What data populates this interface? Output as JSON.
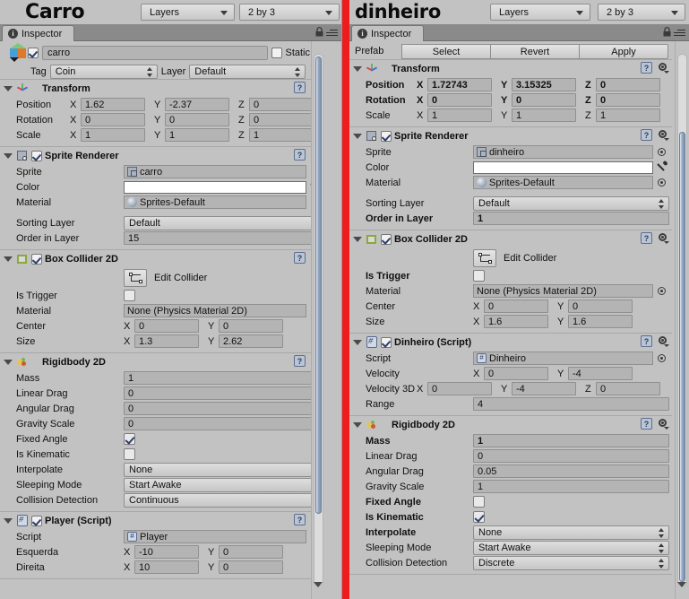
{
  "window": {
    "background_color": "#c2c2c2",
    "divider_color": "#ee1c1c"
  },
  "panels": [
    {
      "id": "left",
      "toolbar": {
        "object_title": "Carro",
        "layers_dropdown": "Layers",
        "layout_dropdown": "2 by 3"
      },
      "tab": {
        "label": "Inspector",
        "icon": "info-icon"
      },
      "object_header": {
        "enabled": true,
        "name": "carro",
        "static_label": "Static",
        "tag_label": "Tag",
        "tag_value": "Coin",
        "layer_label": "Layer",
        "layer_value": "Default"
      },
      "prefab_row": null,
      "components": [
        {
          "name": "Transform",
          "icon": "transform-axis-icon",
          "has_enable_checkbox": false,
          "enabled": false,
          "rows": [
            {
              "type": "vector3",
              "label": "Position",
              "bold": false,
              "x": "1.62",
              "y": "-2.37",
              "z": "0"
            },
            {
              "type": "vector3",
              "label": "Rotation",
              "bold": false,
              "x": "0",
              "y": "0",
              "z": "0"
            },
            {
              "type": "vector3",
              "label": "Scale",
              "bold": false,
              "x": "1",
              "y": "1",
              "z": "1"
            }
          ]
        },
        {
          "name": "Sprite Renderer",
          "icon": "sprite-renderer-icon",
          "has_enable_checkbox": true,
          "enabled": true,
          "rows": [
            {
              "type": "object",
              "label": "Sprite",
              "bold": false,
              "value": "carro",
              "icon": "sprite-asset-icon"
            },
            {
              "type": "color",
              "label": "Color",
              "bold": false,
              "value": "#ffffff"
            },
            {
              "type": "object",
              "label": "Material",
              "bold": false,
              "value": "Sprites-Default",
              "icon": "material-ball-icon"
            },
            {
              "type": "spacer"
            },
            {
              "type": "popup",
              "label": "Sorting Layer",
              "bold": false,
              "value": "Default"
            },
            {
              "type": "text",
              "label": "Order in Layer",
              "bold": false,
              "value": "15"
            }
          ]
        },
        {
          "name": "Box Collider 2D",
          "icon": "box-collider-2d-icon",
          "has_enable_checkbox": true,
          "enabled": true,
          "rows": [
            {
              "type": "editcollider",
              "label": "Edit Collider"
            },
            {
              "type": "checkbox",
              "label": "Is Trigger",
              "bold": false,
              "checked": false
            },
            {
              "type": "object",
              "label": "Material",
              "bold": false,
              "value": "None (Physics Material 2D)",
              "icon": "none-icon"
            },
            {
              "type": "vector2",
              "label": "Center",
              "bold": false,
              "x": "0",
              "y": "0"
            },
            {
              "type": "vector2",
              "label": "Size",
              "bold": false,
              "x": "1.3",
              "y": "2.62"
            }
          ]
        },
        {
          "name": "Rigidbody 2D",
          "icon": "rigidbody-2d-icon",
          "has_enable_checkbox": false,
          "enabled": false,
          "rows": [
            {
              "type": "text",
              "label": "Mass",
              "bold": false,
              "value": "1"
            },
            {
              "type": "text",
              "label": "Linear Drag",
              "bold": false,
              "value": "0"
            },
            {
              "type": "text",
              "label": "Angular Drag",
              "bold": false,
              "value": "0"
            },
            {
              "type": "text",
              "label": "Gravity Scale",
              "bold": false,
              "value": "0"
            },
            {
              "type": "checkbox",
              "label": "Fixed Angle",
              "bold": false,
              "checked": true
            },
            {
              "type": "checkbox",
              "label": "Is Kinematic",
              "bold": false,
              "checked": false
            },
            {
              "type": "popup",
              "label": "Interpolate",
              "bold": false,
              "value": "None"
            },
            {
              "type": "popup",
              "label": "Sleeping Mode",
              "bold": false,
              "value": "Start Awake"
            },
            {
              "type": "popup",
              "label": "Collision Detection",
              "bold": false,
              "value": "Continuous"
            }
          ]
        },
        {
          "name": "Player (Script)",
          "icon": "script-icon",
          "has_enable_checkbox": true,
          "enabled": true,
          "rows": [
            {
              "type": "object",
              "label": "Script",
              "bold": false,
              "value": "Player",
              "icon": "script-asset-icon"
            },
            {
              "type": "vector2",
              "label": "Esquerda",
              "bold": false,
              "x": "-10",
              "y": "0"
            },
            {
              "type": "vector2",
              "label": "Direita",
              "bold": false,
              "x": "10",
              "y": "0"
            }
          ]
        }
      ]
    },
    {
      "id": "right",
      "toolbar": {
        "object_title": "dinheiro",
        "layers_dropdown": "Layers",
        "layout_dropdown": "2 by 3"
      },
      "tab": {
        "label": "Inspector",
        "icon": "info-icon"
      },
      "object_header": null,
      "prefab_row": {
        "label": "Prefab",
        "select_button": "Select",
        "revert_button": "Revert",
        "apply_button": "Apply"
      },
      "components": [
        {
          "name": "Transform",
          "icon": "transform-axis-icon",
          "has_enable_checkbox": false,
          "enabled": false,
          "rows": [
            {
              "type": "vector3",
              "label": "Position",
              "bold": true,
              "x": "1.72743",
              "y": "3.15325",
              "z": "0"
            },
            {
              "type": "vector3",
              "label": "Rotation",
              "bold": true,
              "x": "0",
              "y": "0",
              "z": "0"
            },
            {
              "type": "vector3",
              "label": "Scale",
              "bold": false,
              "x": "1",
              "y": "1",
              "z": "1"
            }
          ]
        },
        {
          "name": "Sprite Renderer",
          "icon": "sprite-renderer-icon",
          "has_enable_checkbox": true,
          "enabled": true,
          "rows": [
            {
              "type": "object",
              "label": "Sprite",
              "bold": false,
              "value": "dinheiro",
              "icon": "sprite-asset-icon"
            },
            {
              "type": "color",
              "label": "Color",
              "bold": false,
              "value": "#ffffff"
            },
            {
              "type": "object",
              "label": "Material",
              "bold": false,
              "value": "Sprites-Default",
              "icon": "material-ball-icon"
            },
            {
              "type": "spacer"
            },
            {
              "type": "popup",
              "label": "Sorting Layer",
              "bold": false,
              "value": "Default"
            },
            {
              "type": "text",
              "label": "Order in Layer",
              "bold": true,
              "value": "1"
            }
          ]
        },
        {
          "name": "Box Collider 2D",
          "icon": "box-collider-2d-icon",
          "has_enable_checkbox": true,
          "enabled": true,
          "rows": [
            {
              "type": "editcollider",
              "label": "Edit Collider"
            },
            {
              "type": "checkbox",
              "label": "Is Trigger",
              "bold": true,
              "checked": false
            },
            {
              "type": "object",
              "label": "Material",
              "bold": false,
              "value": "None (Physics Material 2D)",
              "icon": "none-icon"
            },
            {
              "type": "vector2",
              "label": "Center",
              "bold": false,
              "x": "0",
              "y": "0"
            },
            {
              "type": "vector2",
              "label": "Size",
              "bold": false,
              "x": "1.6",
              "y": "1.6"
            }
          ]
        },
        {
          "name": "Dinheiro (Script)",
          "icon": "script-icon",
          "has_enable_checkbox": true,
          "enabled": true,
          "rows": [
            {
              "type": "object",
              "label": "Script",
              "bold": false,
              "value": "Dinheiro",
              "icon": "script-asset-icon"
            },
            {
              "type": "vector2",
              "label": "Velocity",
              "bold": false,
              "x": "0",
              "y": "-4"
            },
            {
              "type": "vector3",
              "label": "Velocity 3D",
              "bold": false,
              "x": "0",
              "y": "-4",
              "z": "0"
            },
            {
              "type": "text",
              "label": "Range",
              "bold": false,
              "value": "4"
            }
          ]
        },
        {
          "name": "Rigidbody 2D",
          "icon": "rigidbody-2d-icon",
          "has_enable_checkbox": false,
          "enabled": false,
          "rows": [
            {
              "type": "text",
              "label": "Mass",
              "bold": true,
              "value": "1"
            },
            {
              "type": "text",
              "label": "Linear Drag",
              "bold": false,
              "value": "0"
            },
            {
              "type": "text",
              "label": "Angular Drag",
              "bold": false,
              "value": "0.05"
            },
            {
              "type": "text",
              "label": "Gravity Scale",
              "bold": false,
              "value": "1"
            },
            {
              "type": "checkbox",
              "label": "Fixed Angle",
              "bold": true,
              "checked": false
            },
            {
              "type": "checkbox",
              "label": "Is Kinematic",
              "bold": true,
              "checked": true
            },
            {
              "type": "popup",
              "label": "Interpolate",
              "bold": true,
              "value": "None"
            },
            {
              "type": "popup",
              "label": "Sleeping Mode",
              "bold": false,
              "value": "Start Awake"
            },
            {
              "type": "popup",
              "label": "Collision Detection",
              "bold": false,
              "value": "Discrete"
            }
          ]
        }
      ]
    }
  ]
}
